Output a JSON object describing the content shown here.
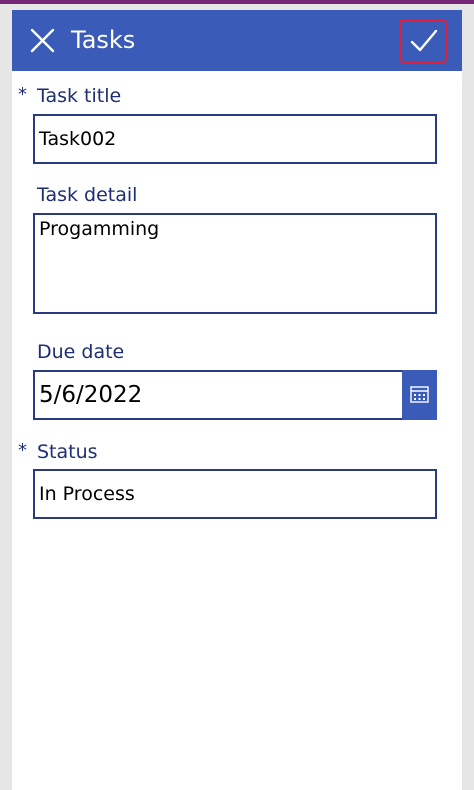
{
  "header": {
    "title": "Tasks",
    "close_icon": "close-icon",
    "submit_icon": "checkmark-icon"
  },
  "fields": {
    "task_title": {
      "label": "Task title",
      "required_marker": "*",
      "value": "Task002"
    },
    "task_detail": {
      "label": "Task detail",
      "value": "Progamming"
    },
    "due_date": {
      "label": "Due date",
      "value": "5/6/2022",
      "icon": "calendar-icon"
    },
    "status": {
      "label": "Status",
      "required_marker": "*",
      "value": "In Process"
    }
  },
  "colors": {
    "header_bg": "#3a5bb7",
    "accent_border": "#2a3a80",
    "label_text": "#1f2d72",
    "highlight": "#e0203a"
  }
}
